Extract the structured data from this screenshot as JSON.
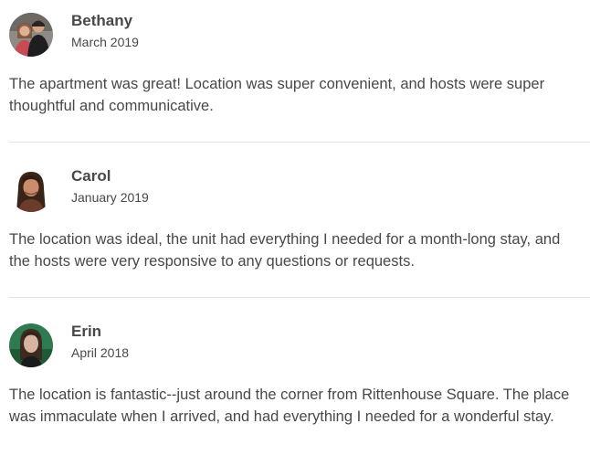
{
  "reviews": [
    {
      "name": "Bethany",
      "date": "March 2019",
      "text": "The apartment was great! Location was super convenient, and hosts were super thoughtful and communicative."
    },
    {
      "name": "Carol",
      "date": "January 2019",
      "text": "The location was ideal, the unit had everything I needed for a month-long stay, and the hosts were very responsive to any questions or requests."
    },
    {
      "name": "Erin",
      "date": "April 2018",
      "text": "The location is fantastic--just around the corner from Rittenhouse Square. The place was immaculate when I arrived, and had everything I needed for a wonderful stay."
    }
  ],
  "colors": {
    "text": "#484848",
    "divider": "#e4e4e4"
  }
}
